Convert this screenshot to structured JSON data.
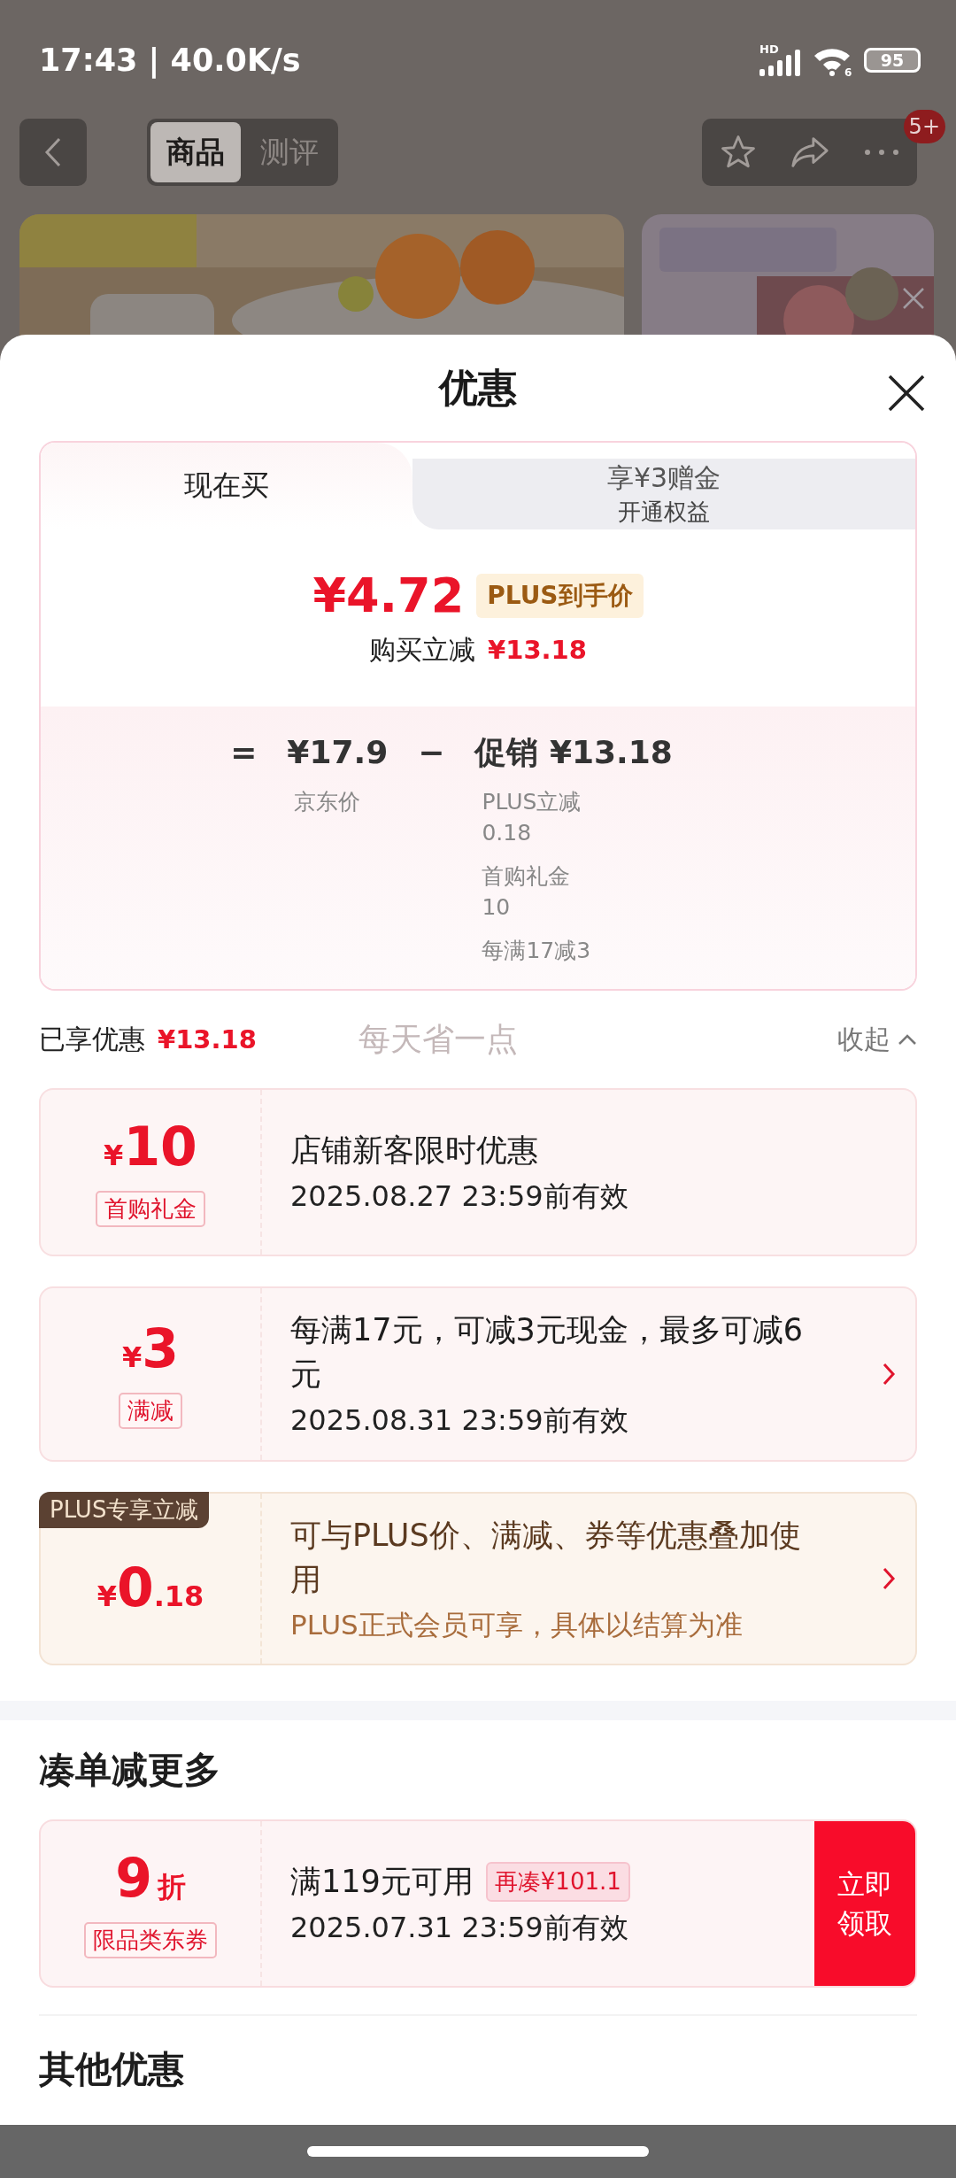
{
  "status_bar": {
    "time": "17:43 | 40.0K/s",
    "signal_label": "HD",
    "wifi_label": "6",
    "battery": "95"
  },
  "nav": {
    "tabs": [
      {
        "label": "商品",
        "selected": true
      },
      {
        "label": "测评",
        "selected": false
      }
    ],
    "badge": "5+"
  },
  "sheet": {
    "title": "优惠"
  },
  "price_card": {
    "tabs": [
      {
        "label": "现在买",
        "selected": true
      },
      {
        "label": "享¥3赠金",
        "sublabel": "开通权益",
        "selected": false
      }
    ],
    "price": "¥4.72",
    "price_tag": "PLUS到手价",
    "saving_label": "购买立减",
    "saving": "¥13.18",
    "equals": "=",
    "base_price": "¥17.9",
    "base_label": "京东价",
    "minus": "−",
    "promo_label": "促销",
    "promo": "¥13.18",
    "promo_items": [
      {
        "name": "PLUS立减",
        "amount": "0.18"
      },
      {
        "name": "首购礼金",
        "amount": "10"
      },
      {
        "name": "每满17减3"
      }
    ]
  },
  "summary": {
    "label": "已享优惠",
    "amount": "¥13.18",
    "slogan": "每天省一点",
    "toggle": "收起"
  },
  "coupons": [
    {
      "kind": "standard",
      "currency": "¥",
      "amount": "10",
      "tag": "首购礼金",
      "title": "店铺新客限时优惠",
      "valid": "2025.08.27 23:59前有效",
      "has_arrow": false
    },
    {
      "kind": "standard",
      "currency": "¥",
      "amount": "3",
      "tag": "满减",
      "title": "每满17元，可减3元现金，最多可减6元",
      "valid": "2025.08.31 23:59前有效",
      "has_arrow": true
    },
    {
      "kind": "plus",
      "ribbon": "PLUS专享立减",
      "currency": "¥",
      "amount": "0",
      "decimal": ".18",
      "title": "可与PLUS价、满减、券等优惠叠加使用",
      "note": "PLUS正式会员可享，具体以结算为准",
      "has_arrow": true
    }
  ],
  "bundle": {
    "title": "凑单减更多",
    "coupon": {
      "amount": "9",
      "unit": "折",
      "tag": "限品类东券",
      "title": "满119元可用",
      "gap": "再凑¥101.1",
      "valid": "2025.07.31 23:59前有效",
      "action": "立即领取"
    }
  },
  "other": {
    "title": "其他优惠"
  }
}
